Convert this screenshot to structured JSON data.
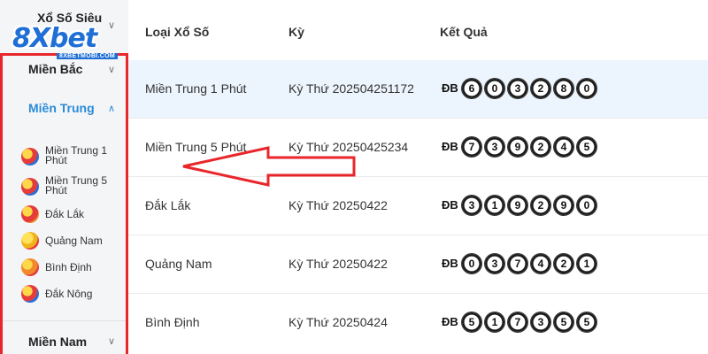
{
  "brand": {
    "logo_text": "8Xbet",
    "logo_sub": "8XBETMOBI.COM",
    "accent": "#1f6fd6"
  },
  "sidebar": {
    "top_label": "Xổ Số Siêu",
    "regions": [
      {
        "label": "Miền Bắc"
      },
      {
        "label": "Miền Trung"
      },
      {
        "label": "Miền Nam"
      }
    ],
    "sub_items": [
      {
        "label_line1": "Miền Trung 1",
        "label_line2": "Phút",
        "icon": "lottery-ball-icon"
      },
      {
        "label_line1": "Miền Trung 5",
        "label_line2": "Phút",
        "icon": "lottery-ball-icon"
      },
      {
        "label_line1": "Đắk Lắk",
        "label_line2": "",
        "icon": "lottery-ball-icon"
      },
      {
        "label_line1": "Quảng Nam",
        "label_line2": "",
        "icon": "lottery-ball-icon"
      },
      {
        "label_line1": "Bình Định",
        "label_line2": "",
        "icon": "lottery-ball-icon"
      },
      {
        "label_line1": "Đắk Nông",
        "label_line2": "",
        "icon": "lottery-ball-icon"
      }
    ],
    "highlight_color": "#e8262b",
    "active_color": "#2a8bd8"
  },
  "table": {
    "headers": {
      "type": "Loại Xổ Số",
      "period": "Kỳ",
      "result": "Kết Quả"
    },
    "rows": [
      {
        "type": "Miền Trung 1 Phút",
        "period": "Kỳ Thứ 202504251172",
        "prize": "ĐB",
        "digits": [
          "6",
          "0",
          "3",
          "2",
          "8",
          "0"
        ]
      },
      {
        "type": "Miền Trung 5 Phút",
        "period": "Kỳ Thứ 20250425234",
        "prize": "ĐB",
        "digits": [
          "7",
          "3",
          "9",
          "2",
          "4",
          "5"
        ]
      },
      {
        "type": "Đắk Lắk",
        "period": "Kỳ Thứ 20250422",
        "prize": "ĐB",
        "digits": [
          "3",
          "1",
          "9",
          "2",
          "9",
          "0"
        ]
      },
      {
        "type": "Quảng Nam",
        "period": "Kỳ Thứ 20250422",
        "prize": "ĐB",
        "digits": [
          "0",
          "3",
          "7",
          "4",
          "2",
          "1"
        ]
      },
      {
        "type": "Bình Định",
        "period": "Kỳ Thứ 20250424",
        "prize": "ĐB",
        "digits": [
          "5",
          "1",
          "7",
          "3",
          "5",
          "5"
        ]
      }
    ]
  }
}
